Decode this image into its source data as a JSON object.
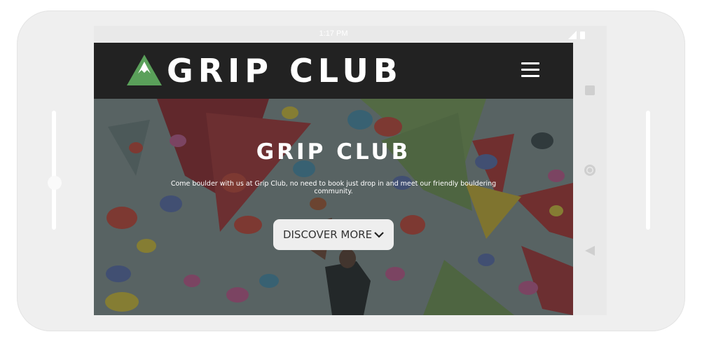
{
  "status_bar": {
    "time": "1:17 PM"
  },
  "header": {
    "logo_text": "GRIP CLUB",
    "menu_icon": "hamburger-menu-icon"
  },
  "hero": {
    "title": "GRIP CLUB",
    "description": "Come boulder with us at Grip Club, no need to book just drop in and meet our friendly bouldering community.",
    "button_label": "DISCOVER MORE",
    "button_icon": "chevron-down-icon"
  },
  "colors": {
    "header_bg": "#222222",
    "logo_green": "#5aa05a",
    "button_bg": "#eeeeee",
    "device_frame": "#efefef"
  }
}
